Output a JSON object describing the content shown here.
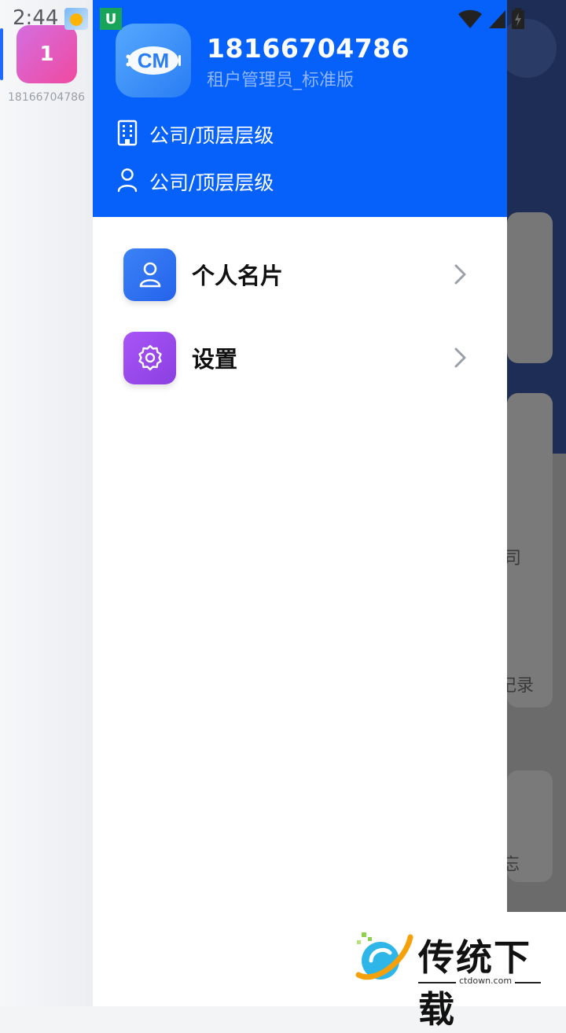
{
  "status_bar": {
    "time": "2:44",
    "app_badge": "U"
  },
  "rail": {
    "avatar_label": "1",
    "account_name": "18166704786"
  },
  "drawer": {
    "logo_text": "CM",
    "phone": "18166704786",
    "role": "租户管理员_标准版",
    "company": "公司/顶层层级",
    "department": "公司/顶层层级",
    "menu": [
      {
        "label": "个人名片",
        "icon": "user-icon",
        "color": "#3478f6"
      },
      {
        "label": "设置",
        "icon": "gear-icon",
        "color": "#9b45e6"
      }
    ]
  },
  "background": {
    "fragment_1": "司",
    "fragment_2": "记录",
    "fragment_3": "忘"
  },
  "watermark": {
    "title": "传统下载",
    "url": "ctdown.com"
  },
  "colors": {
    "primary": "#0561fa",
    "rail_avatar": "#e05ab8"
  }
}
